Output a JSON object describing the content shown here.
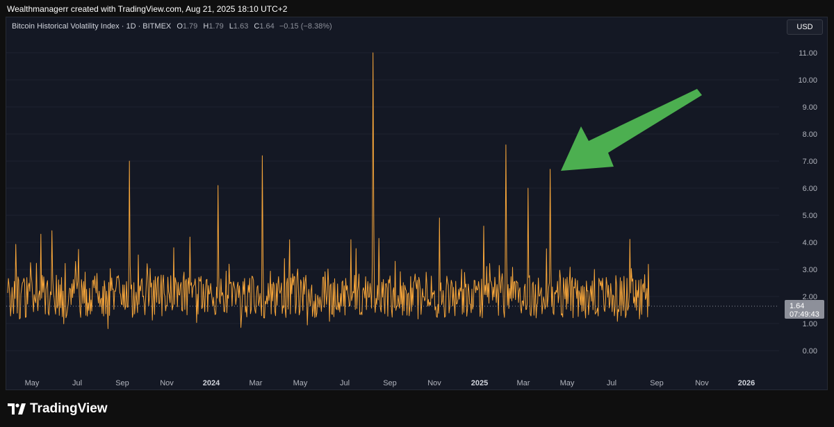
{
  "credit": "Wealthmanagerr created with TradingView.com, Aug 21, 2025 18:10 UTC+2",
  "legend": {
    "symbol": "Bitcoin Historical Volatility Index · 1D · BITMEX",
    "o_label": "O",
    "o_value": "1.79",
    "h_label": "H",
    "h_value": "1.79",
    "l_label": "L",
    "l_value": "1.63",
    "c_label": "C",
    "c_value": "1.64",
    "change": "−0.15 (−8.38%)"
  },
  "currency": "USD",
  "price_tag": {
    "value": "1.64",
    "countdown": "07:49:43"
  },
  "brand": "TradingView",
  "colors": {
    "series": "#f7a63a",
    "background": "#141824",
    "grid": "#1e2230",
    "arrow": "#4caf50",
    "price_line": "#8d909a"
  },
  "chart_data": {
    "type": "line",
    "title": "Bitcoin Historical Volatility Index · 1D · BITMEX",
    "ylim": [
      0,
      11.5
    ],
    "y_ticks": [
      "0.00",
      "1.00",
      "2.00",
      "3.00",
      "4.00",
      "5.00",
      "6.00",
      "7.00",
      "8.00",
      "9.00",
      "10.00",
      "11.00"
    ],
    "x_ticks": [
      {
        "label": "May",
        "bold": false
      },
      {
        "label": "Jul",
        "bold": false
      },
      {
        "label": "Sep",
        "bold": false
      },
      {
        "label": "Nov",
        "bold": false
      },
      {
        "label": "2024",
        "bold": true
      },
      {
        "label": "Mar",
        "bold": false
      },
      {
        "label": "May",
        "bold": false
      },
      {
        "label": "Jul",
        "bold": false
      },
      {
        "label": "Sep",
        "bold": false
      },
      {
        "label": "Nov",
        "bold": false
      },
      {
        "label": "2025",
        "bold": true
      },
      {
        "label": "Mar",
        "bold": false
      },
      {
        "label": "May",
        "bold": false
      },
      {
        "label": "Jul",
        "bold": false
      },
      {
        "label": "Sep",
        "bold": false
      },
      {
        "label": "Nov",
        "bold": false
      },
      {
        "label": "2026",
        "bold": true
      }
    ],
    "x": [
      "2023-04",
      "2023-05",
      "2023-06",
      "2023-07",
      "2023-08",
      "2023-09",
      "2023-10",
      "2023-11",
      "2023-12",
      "2024-01",
      "2024-02",
      "2024-03",
      "2024-04",
      "2024-05",
      "2024-06",
      "2024-07",
      "2024-08",
      "2024-09",
      "2024-10",
      "2024-11",
      "2024-12",
      "2025-01",
      "2025-02",
      "2025-03",
      "2025-04",
      "2025-05",
      "2025-06",
      "2025-07",
      "2025-08"
    ],
    "series": [
      {
        "values": [
          2.6,
          4.3,
          2.2,
          2.9,
          1.8,
          7.0,
          2.5,
          3.8,
          2.3,
          6.1,
          1.9,
          7.2,
          3.4,
          2.1,
          2.4,
          4.1,
          11.0,
          3.3,
          2.6,
          4.9,
          3.0,
          4.6,
          7.6,
          6.0,
          6.7,
          2.7,
          3.0,
          2.4,
          2.6
        ]
      }
    ],
    "last_value": 1.64,
    "annotation": {
      "type": "arrow",
      "points_to": "2025-04",
      "value": 6.7
    }
  }
}
